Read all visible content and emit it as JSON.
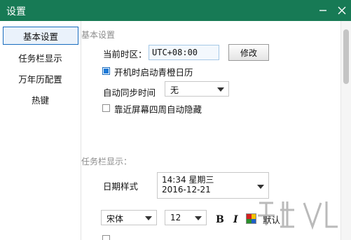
{
  "window": {
    "title": "设置"
  },
  "sidebar": {
    "items": [
      {
        "label": "基本设置",
        "active": true
      },
      {
        "label": "任务栏显示",
        "active": false
      },
      {
        "label": "万年历配置",
        "active": false
      },
      {
        "label": "热键",
        "active": false
      }
    ]
  },
  "basic": {
    "section_title": "基本设置",
    "timezone_label": "当前时区：",
    "timezone_value": "UTC+08:00",
    "modify_button": "修改",
    "startup_label": "开机时启动青橙日历",
    "startup_checked": true,
    "autosync_label": "自动同步时间",
    "autosync_value": "无",
    "autohide_label": "靠近屏幕四周自动隐藏",
    "autohide_checked": false
  },
  "taskbar": {
    "section_title": "任务栏显示：",
    "date_style_label": "日期样式",
    "date_style_line1": "14:34 星期三",
    "date_style_line2": "2016-12-21",
    "font_family_value": "宋体",
    "font_size_value": "12",
    "bold_label": "B",
    "italic_label": "I",
    "default_label": "默认",
    "color_swatches": [
      "#d42020",
      "#f2c200",
      "#2a8f2a",
      "#1f5fc7"
    ]
  },
  "colors": {
    "titlebar": "#177a55",
    "accent": "#1a6dbf"
  },
  "icons": {
    "minimize": "minimize-icon",
    "close": "close-icon",
    "color_picker": "color-palette-icon"
  }
}
